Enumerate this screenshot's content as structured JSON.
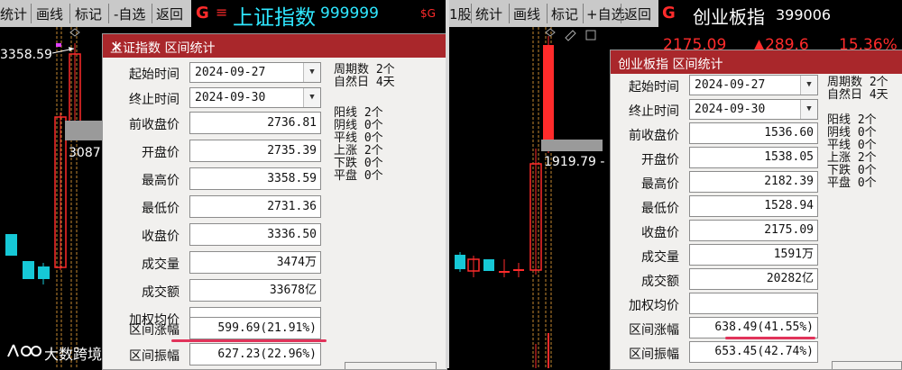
{
  "left_toolbar": {
    "items": [
      "统计",
      "画线",
      "标记",
      "-自选",
      "返回"
    ]
  },
  "left_header": {
    "logo": "G",
    "menu_glyph": "≡",
    "index_name": "上证指数",
    "index_code": "999999"
  },
  "right_toolbar": {
    "partial": "$G",
    "items": [
      "1股",
      "统计",
      "画线",
      "标记",
      "+自选",
      "返回"
    ]
  },
  "right_header": {
    "logo": "G",
    "index_name": "创业板指",
    "index_code": "399006"
  },
  "right_quote": {
    "price": "2175.09",
    "change": "▲289.6",
    "change_pct": "15.36%"
  },
  "left_chart": {
    "high_label": "3358.59",
    "mid_label": "3087."
  },
  "right_chart": {
    "mid_label": "1919.79 -"
  },
  "left_panel": {
    "title": "上证指数 区间统计",
    "start_label": "起始时间",
    "start_value": "2024-09-27",
    "end_label": "终止时间",
    "end_value": "2024-09-30",
    "rows": [
      {
        "label": "前收盘价",
        "value": "2736.81"
      },
      {
        "label": "开盘价",
        "value": "2735.39"
      },
      {
        "label": "最高价",
        "value": "3358.59"
      },
      {
        "label": "最低价",
        "value": "2731.36"
      },
      {
        "label": "收盘价",
        "value": "3336.50"
      },
      {
        "label": "成交量",
        "value": "3474万"
      },
      {
        "label": "成交额",
        "value": "33678亿"
      },
      {
        "label": "加权均价",
        "value": ""
      },
      {
        "label": "区间涨幅",
        "value": "599.69(21.91%)"
      },
      {
        "label": "区间振幅",
        "value": "627.23(22.96%)"
      }
    ],
    "stats": [
      "周期数  2个",
      "自然日  4天",
      "",
      "阳线  2个",
      "阴线  0个",
      "平线  0个",
      "上涨  2个",
      "下跌  0个",
      "平盘  0个"
    ]
  },
  "right_panel": {
    "title": "创业板指 区间统计",
    "start_label": "起始时间",
    "start_value": "2024-09-27",
    "end_label": "终止时间",
    "end_value": "2024-09-30",
    "rows": [
      {
        "label": "前收盘价",
        "value": "1536.60"
      },
      {
        "label": "开盘价",
        "value": "1538.05"
      },
      {
        "label": "最高价",
        "value": "2182.39"
      },
      {
        "label": "最低价",
        "value": "1528.94"
      },
      {
        "label": "收盘价",
        "value": "2175.09"
      },
      {
        "label": "成交量",
        "value": "1591万"
      },
      {
        "label": "成交额",
        "value": "20282亿"
      },
      {
        "label": "加权均价",
        "value": ""
      },
      {
        "label": "区间涨幅",
        "value": "638.49(41.55%)"
      },
      {
        "label": "区间振幅",
        "value": "653.45(42.74%)"
      }
    ],
    "stats": [
      "周期数  2个",
      "自然日  4天",
      "",
      "阳线  2个",
      "阴线  0个",
      "平线  0个",
      "上涨  2个",
      "下跌  0个",
      "平盘  0个"
    ]
  },
  "watermark": {
    "text": "大数跨境"
  },
  "colors": {
    "title_bar": "#a9272b",
    "rise": "#ff2b2b",
    "fall": "#16c8d6",
    "highlight": "#e1335a"
  }
}
